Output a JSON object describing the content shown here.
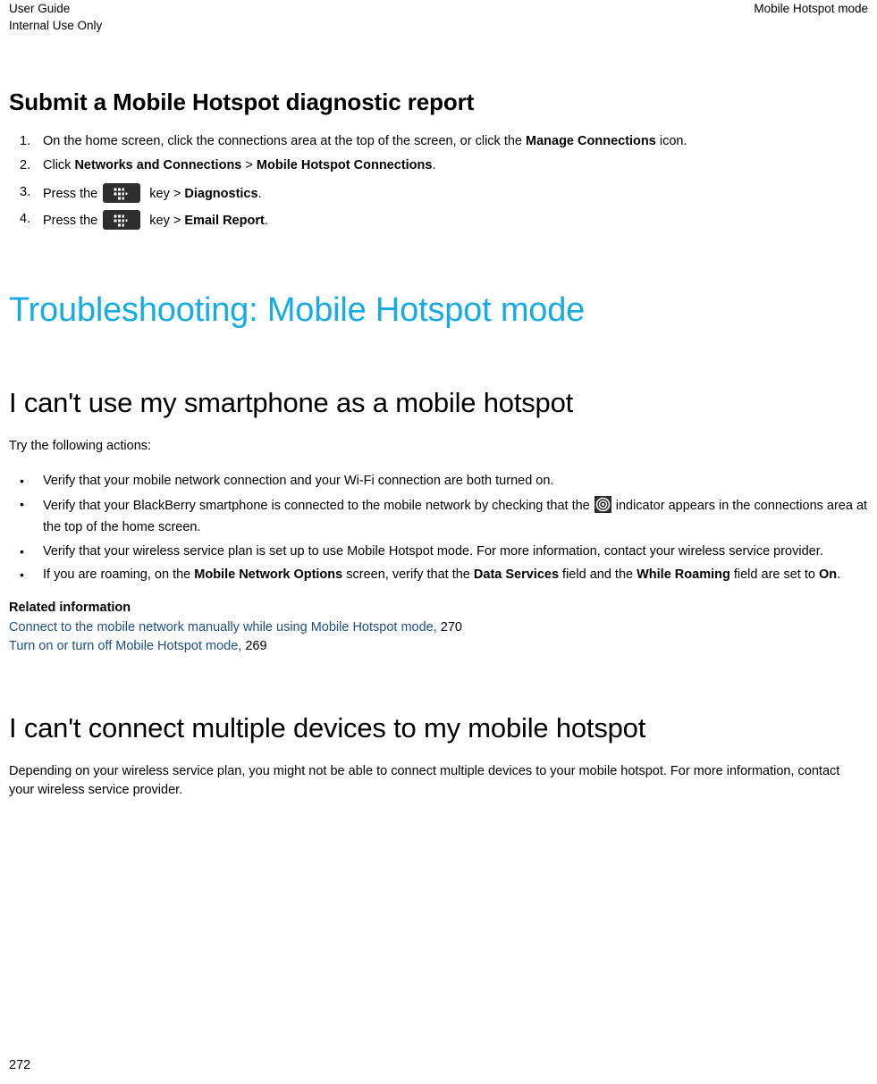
{
  "header": {
    "left_line1": "User Guide",
    "left_line2": "Internal Use Only",
    "right": "Mobile Hotspot mode"
  },
  "topic": {
    "title": "Submit a Mobile Hotspot diagnostic report",
    "steps": [
      {
        "num": "1.",
        "parts": [
          {
            "type": "text",
            "text": "On the home screen, click the connections area at the top of the screen, or click the "
          },
          {
            "type": "bold",
            "text": "Manage Connections"
          },
          {
            "type": "text",
            "text": " icon."
          }
        ]
      },
      {
        "num": "2.",
        "parts": [
          {
            "type": "text",
            "text": "Click "
          },
          {
            "type": "bold",
            "text": "Networks and Connections"
          },
          {
            "type": "text",
            "text": " > "
          },
          {
            "type": "bold",
            "text": "Mobile Hotspot Connections"
          },
          {
            "type": "text",
            "text": "."
          }
        ]
      },
      {
        "num": "3.",
        "prefix": "Press the",
        "icon": "blackberry-menu-key-icon",
        "suffix_plain": " key > ",
        "suffix_bold": "Diagnostics",
        "suffix_end": "."
      },
      {
        "num": "4.",
        "prefix": "Press the",
        "icon": "blackberry-menu-key-icon",
        "suffix_plain": " key > ",
        "suffix_bold": "Email Report",
        "suffix_end": "."
      }
    ]
  },
  "section": {
    "title": "Troubleshooting: Mobile Hotspot mode"
  },
  "trouble1": {
    "title": "I can't use my smartphone as a mobile hotspot",
    "intro": "Try the following actions:",
    "bullets": {
      "b1": "Verify that your mobile network connection and your Wi-Fi connection are both turned on.",
      "b2_before": "Verify that your BlackBerry smartphone is connected to the mobile network by checking that the",
      "b2_icon": "mobile-network-indicator-icon",
      "b2_after": "indicator appears in the connections area at the top of the home screen.",
      "b3": "Verify that your wireless service plan is set up to use Mobile Hotspot mode. For more information, contact your wireless service provider.",
      "b4_p1": "If you are roaming, on the ",
      "b4_b1": "Mobile Network Options",
      "b4_p2": " screen, verify that the ",
      "b4_b2": "Data Services",
      "b4_p3": " field and the ",
      "b4_b3": "While Roaming",
      "b4_p4": " field are set to ",
      "b4_b4": "On",
      "b4_p5": "."
    },
    "related": {
      "heading": "Related information",
      "links": [
        {
          "label": "Connect to the mobile network manually while using Mobile Hotspot mode,",
          "page": "270"
        },
        {
          "label": "Turn on or turn off Mobile Hotspot mode,",
          "page": "269"
        }
      ]
    }
  },
  "trouble2": {
    "title": "I can't connect multiple devices to my mobile hotspot",
    "body": "Depending on your wireless service plan, you might not be able to connect multiple devices to your mobile hotspot. For more information, contact your wireless service provider."
  },
  "footer": {
    "page_number": "272"
  },
  "colors": {
    "section_heading": "#16ABE3",
    "link": "#1F4E8C",
    "icon_background": "#2E2E2E",
    "text": "#000000"
  }
}
